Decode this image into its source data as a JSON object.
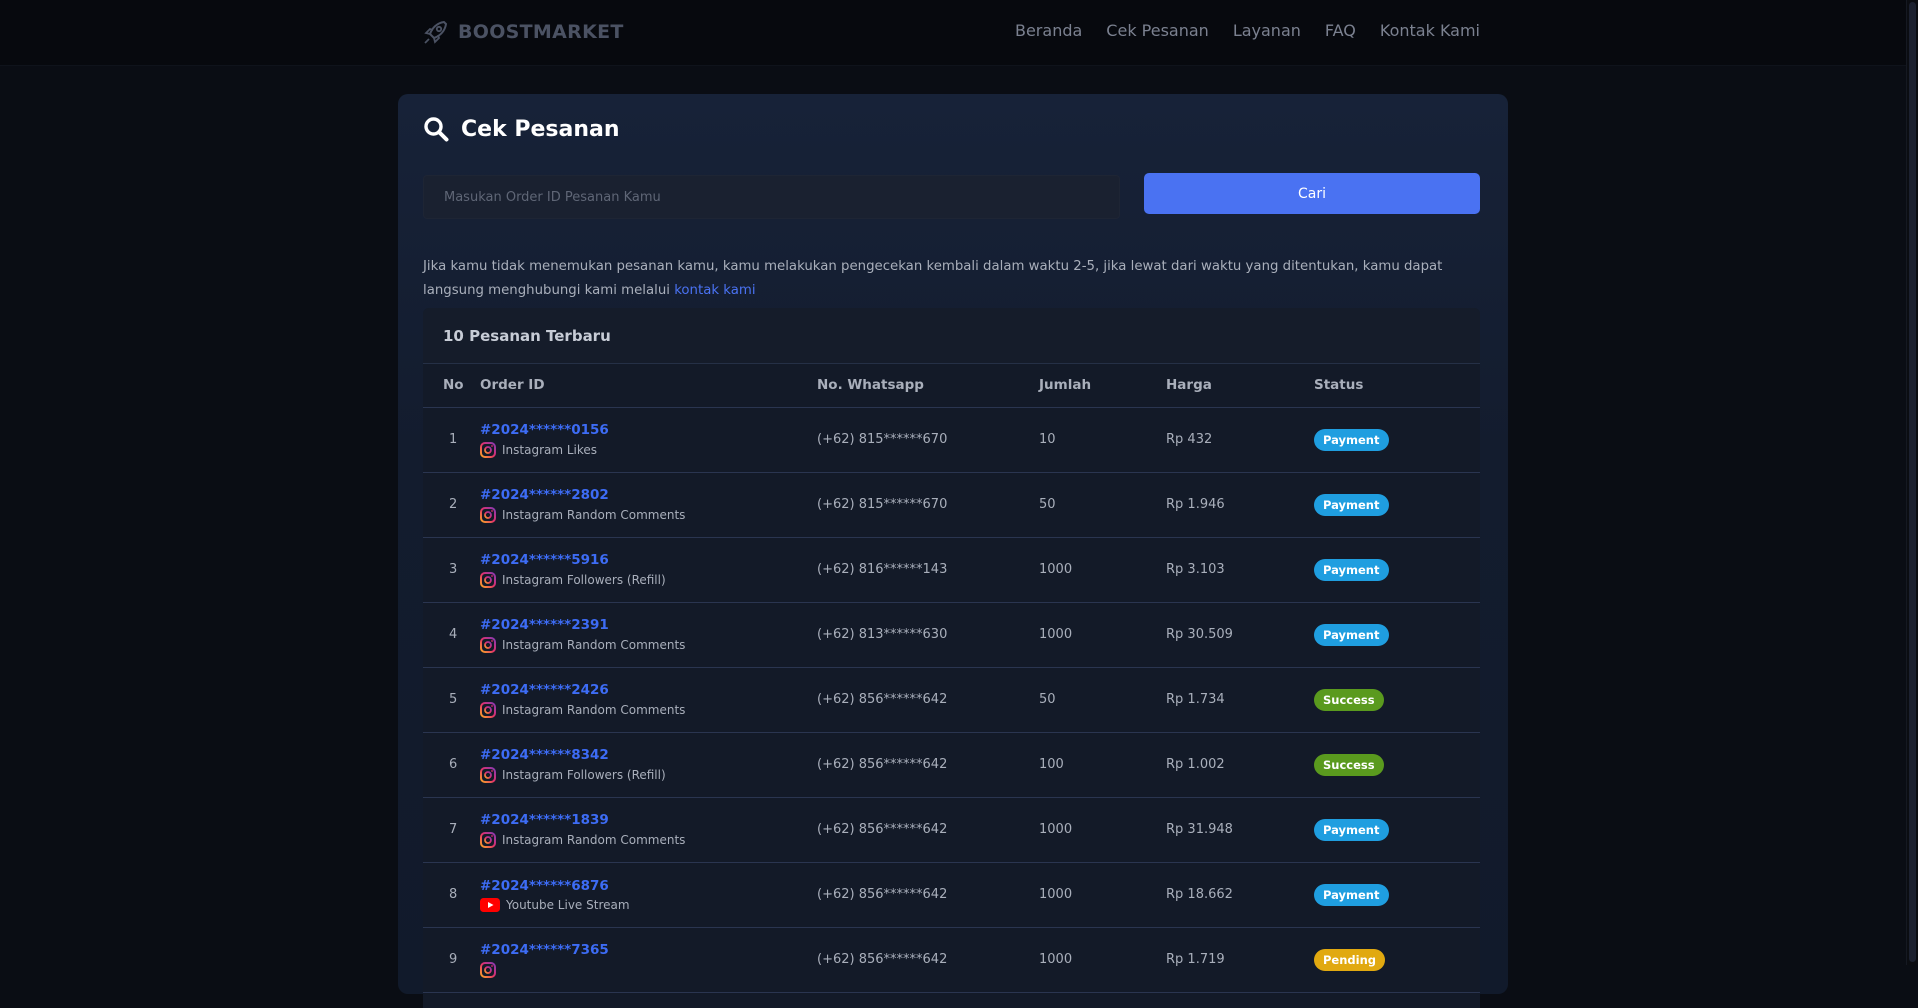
{
  "nav": {
    "brand": "BOOSTMARKET",
    "links": [
      "Beranda",
      "Cek Pesanan",
      "Layanan",
      "FAQ",
      "Kontak Kami"
    ]
  },
  "page": {
    "title": "Cek Pesanan",
    "search_placeholder": "Masukan Order ID Pesanan Kamu",
    "search_button": "Cari",
    "notice_text": "Jika kamu tidak menemukan pesanan kamu, kamu melakukan pengecekan kembali dalam waktu 2-5, jika lewat dari waktu yang ditentukan, kamu dapat langsung menghubungi kami melalui ",
    "notice_link": "kontak kami"
  },
  "table": {
    "heading": "10 Pesanan Terbaru",
    "columns": [
      "No",
      "Order ID",
      "No. Whatsapp",
      "Jumlah",
      "Harga",
      "Status"
    ],
    "rows": [
      {
        "no": "1",
        "order_id": "#2024******0156",
        "service": "Instagram Likes",
        "platform": "instagram-icon",
        "whatsapp": "(+62) 815******670",
        "qty": "10",
        "price": "Rp 432",
        "status": "Payment"
      },
      {
        "no": "2",
        "order_id": "#2024******2802",
        "service": "Instagram Random Comments",
        "platform": "instagram-icon",
        "whatsapp": "(+62) 815******670",
        "qty": "50",
        "price": "Rp 1.946",
        "status": "Payment"
      },
      {
        "no": "3",
        "order_id": "#2024******5916",
        "service": "Instagram Followers (Refill)",
        "platform": "instagram-icon",
        "whatsapp": "(+62) 816******143",
        "qty": "1000",
        "price": "Rp 3.103",
        "status": "Payment"
      },
      {
        "no": "4",
        "order_id": "#2024******2391",
        "service": "Instagram Random Comments",
        "platform": "instagram-icon",
        "whatsapp": "(+62) 813******630",
        "qty": "1000",
        "price": "Rp 30.509",
        "status": "Payment"
      },
      {
        "no": "5",
        "order_id": "#2024******2426",
        "service": "Instagram Random Comments",
        "platform": "instagram-icon",
        "whatsapp": "(+62) 856******642",
        "qty": "50",
        "price": "Rp 1.734",
        "status": "Success"
      },
      {
        "no": "6",
        "order_id": "#2024******8342",
        "service": "Instagram Followers (Refill)",
        "platform": "instagram-icon",
        "whatsapp": "(+62) 856******642",
        "qty": "100",
        "price": "Rp 1.002",
        "status": "Success"
      },
      {
        "no": "7",
        "order_id": "#2024******1839",
        "service": "Instagram Random Comments",
        "platform": "instagram-icon",
        "whatsapp": "(+62) 856******642",
        "qty": "1000",
        "price": "Rp 31.948",
        "status": "Payment"
      },
      {
        "no": "8",
        "order_id": "#2024******6876",
        "service": "Youtube Live Stream",
        "platform": "youtube-icon",
        "whatsapp": "(+62) 856******642",
        "qty": "1000",
        "price": "Rp 18.662",
        "status": "Payment"
      },
      {
        "no": "9",
        "order_id": "#2024******7365",
        "service": "",
        "platform": "instagram-icon",
        "whatsapp": "(+62) 856******642",
        "qty": "1000",
        "price": "Rp 1.719",
        "status": "Pending"
      }
    ]
  },
  "status_colors": {
    "Payment": "#1f9ee0",
    "Success": "#5a9a1e",
    "Pending": "#e1a910"
  }
}
